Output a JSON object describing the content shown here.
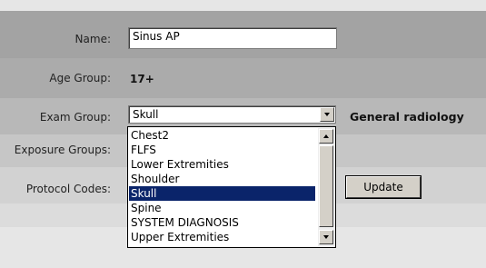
{
  "form": {
    "name_label": "Name:",
    "name_value": "Sinus AP",
    "age_group_label": "Age Group:",
    "age_group_value": "17+",
    "exam_group_label": "Exam Group:",
    "exam_group_selected": "Skull",
    "exam_group_category": "General radiology",
    "exposure_groups_label": "Exposure Groups:",
    "protocol_codes_label": "Protocol Codes:",
    "update_label": "Update"
  },
  "exam_group_options": [
    "Chest2",
    "FLFS",
    "Lower Extremities",
    "Shoulder",
    "Skull",
    "Spine",
    "SYSTEM DIAGNOSIS",
    "Upper Extremities"
  ],
  "selected_option": "Skull",
  "colors": {
    "band_dark": "#a3a3a3",
    "band_mid": "#bdbdbd",
    "band_light": "#d9d9d9",
    "selection": "#0a246a"
  }
}
